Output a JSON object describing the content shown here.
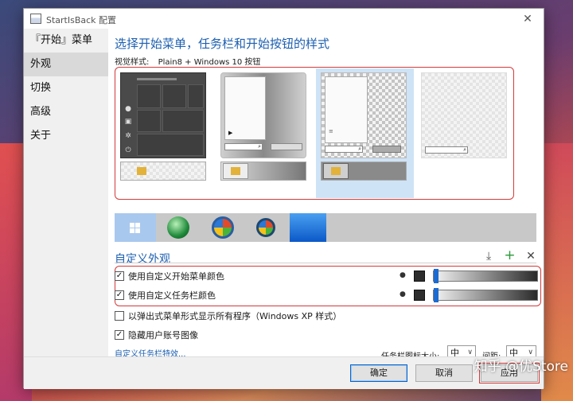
{
  "window": {
    "title": "StartIsBack 配置",
    "close_glyph": "✕"
  },
  "sidebar": {
    "items": [
      {
        "label": "『开始』菜单",
        "active": false
      },
      {
        "label": "外观",
        "active": true
      },
      {
        "label": "切换",
        "active": false
      },
      {
        "label": "高级",
        "active": false
      },
      {
        "label": "关于",
        "active": false
      }
    ]
  },
  "main": {
    "title": "选择开始菜单，任务栏和开始按钮的样式",
    "visual_style_label": "视觉样式:",
    "visual_style_value": "Plain8 + Windows 10 按钮"
  },
  "custom": {
    "title": "自定义外观",
    "tools": {
      "download": "⤓",
      "add": "+",
      "remove": "✕"
    },
    "options": [
      {
        "label": "使用自定义开始菜单颜色",
        "checked": true,
        "check_glyph": "✓"
      },
      {
        "label": "使用自定义任务栏颜色",
        "checked": true,
        "check_glyph": "✓"
      },
      {
        "label": "以弹出式菜单形式显示所有程序（Windows XP 样式）",
        "checked": false,
        "check_glyph": ""
      },
      {
        "label": "隐藏用户账号图像",
        "checked": true,
        "check_glyph": "✓"
      }
    ],
    "drop_glyph": "●",
    "link": "自定义任务栏特效...",
    "icon_size_label": "任务栏图标大小:",
    "icon_size_value": "中",
    "spacing_label": "间距:",
    "spacing_value": "中",
    "select_arrow": "∨"
  },
  "footer": {
    "ok": "确定",
    "cancel": "取消",
    "apply": "应用"
  },
  "watermark": "知乎 @优Store",
  "colors": {
    "accent": "#1c5fb0",
    "highlight_red": "#d23a3a",
    "selection_blue": "#cfe3f7",
    "slider_knob": "#1d6bd1"
  }
}
